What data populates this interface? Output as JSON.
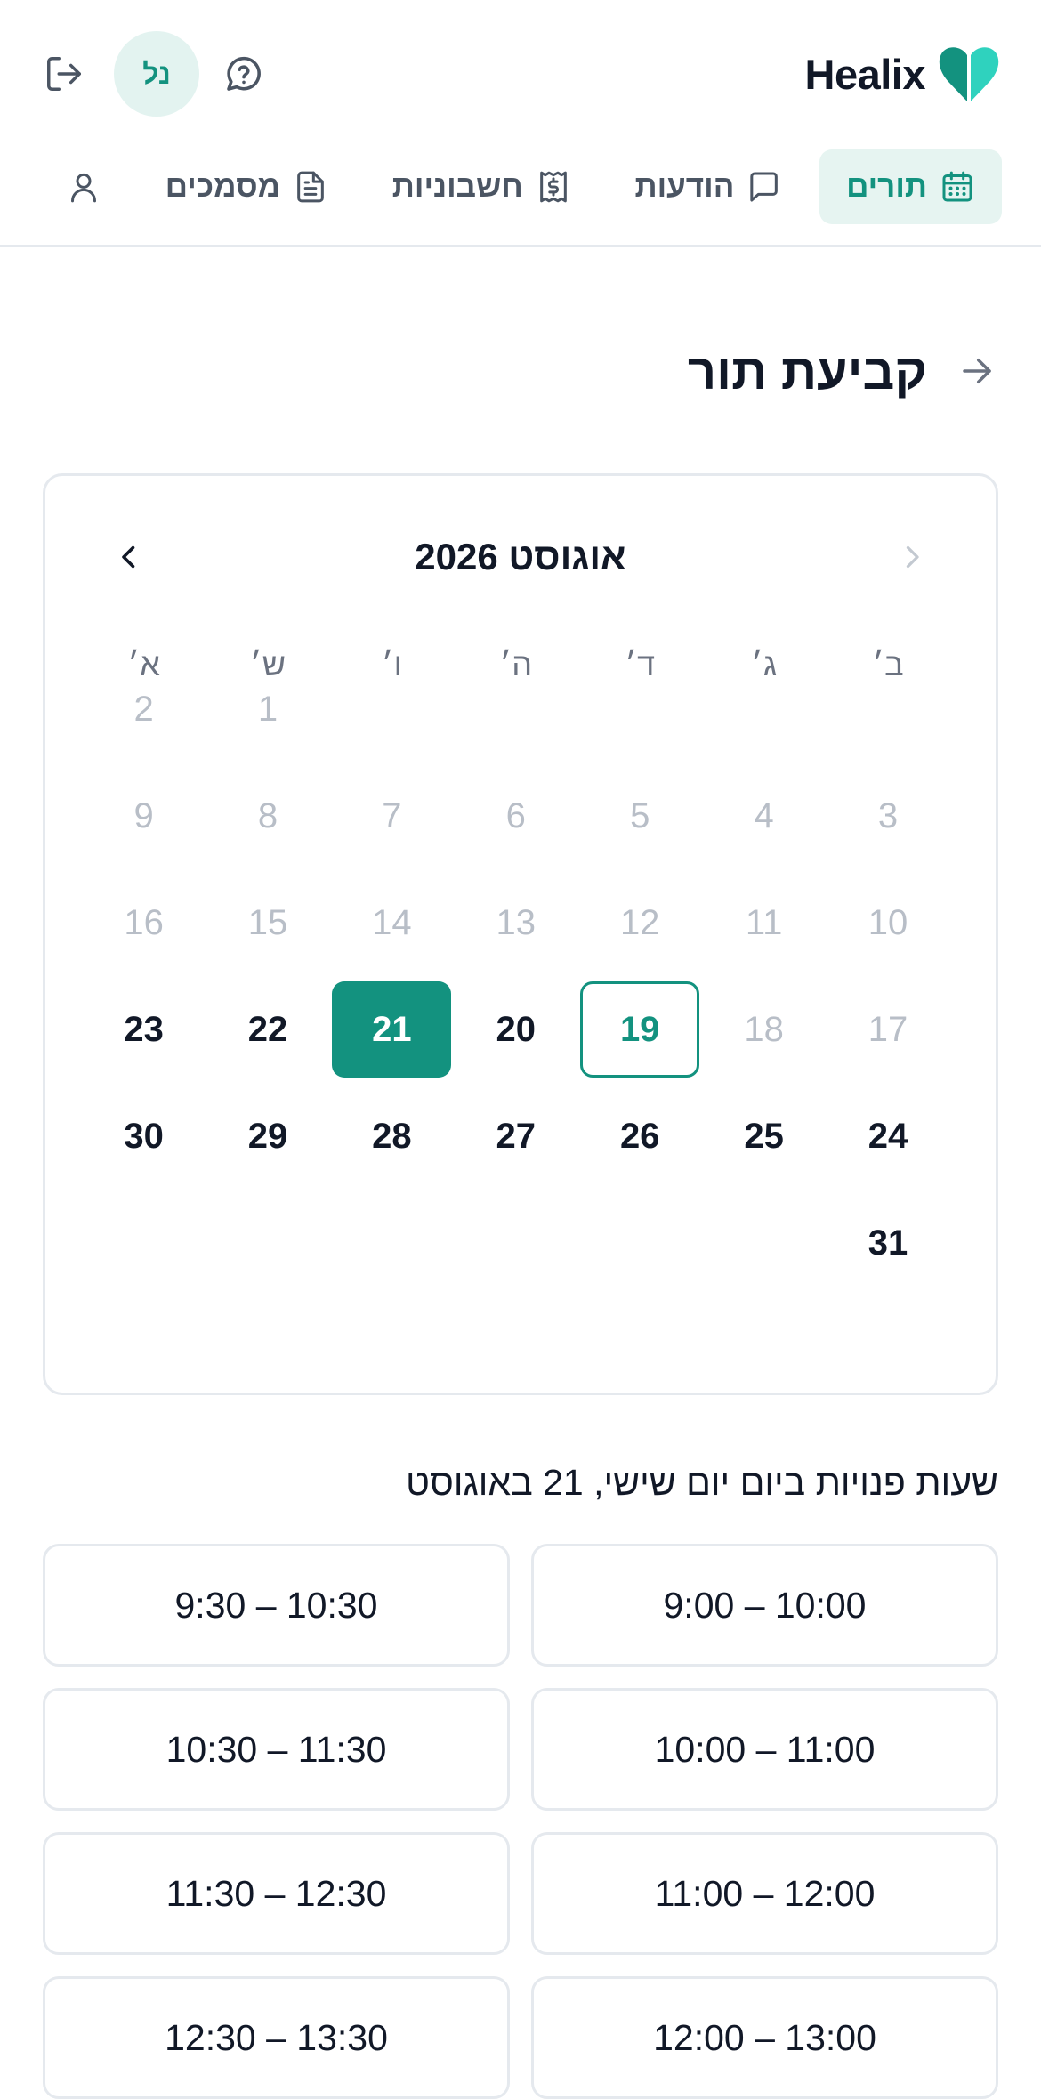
{
  "brand": {
    "name": "Healix",
    "color": "#13927f",
    "accent": "#2fd2be"
  },
  "user": {
    "initials": "נל"
  },
  "nav": {
    "tabs": [
      {
        "label": "תורים",
        "icon": "calendar-icon",
        "active": true
      },
      {
        "label": "הודעות",
        "icon": "message-icon",
        "active": false
      },
      {
        "label": "חשבוניות",
        "icon": "receipt-icon",
        "active": false
      },
      {
        "label": "מסמכים",
        "icon": "document-icon",
        "active": false
      }
    ]
  },
  "page": {
    "title": "קביעת תור"
  },
  "calendar": {
    "month_label": "אוגוסט 2026",
    "weekdays": [
      "ב׳",
      "ג׳",
      "ד׳",
      "ה׳",
      "ו׳",
      "ש׳",
      "א׳"
    ],
    "first_day_col": 5,
    "days_in_month": 31,
    "first_enabled_day": 19,
    "today": 19,
    "selected": 21,
    "disabled_extra": [
      18
    ]
  },
  "slots": {
    "label": "שעות פנויות ביום יום שישי, 21 באוגוסט",
    "items": [
      "9:00 – 10:00",
      "9:30 – 10:30",
      "10:00 – 11:00",
      "10:30 – 11:30",
      "11:00 – 12:00",
      "11:30 – 12:30",
      "12:00 – 13:00",
      "12:30 – 13:30"
    ]
  },
  "colors": {
    "primary": "#13927f",
    "primary_soft": "#e6f4f1",
    "border": "#e5e9ee",
    "muted": "#b8bec7"
  }
}
